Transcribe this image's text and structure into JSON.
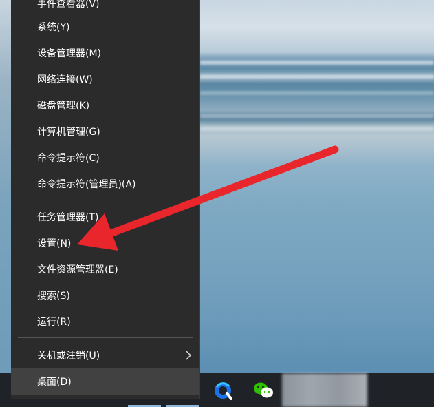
{
  "context_menu": {
    "items": [
      {
        "label": "事件查看器(V)"
      },
      {
        "label": "系统(Y)"
      },
      {
        "label": "设备管理器(M)"
      },
      {
        "label": "网络连接(W)"
      },
      {
        "label": "磁盘管理(K)"
      },
      {
        "label": "计算机管理(G)"
      },
      {
        "label": "命令提示符(C)"
      },
      {
        "label": "命令提示符(管理员)(A)"
      },
      {
        "label": "任务管理器(T)"
      },
      {
        "label": "设置(N)"
      },
      {
        "label": "文件资源管理器(E)"
      },
      {
        "label": "搜索(S)"
      },
      {
        "label": "运行(R)"
      },
      {
        "label": "关机或注销(U)"
      },
      {
        "label": "桌面(D)"
      }
    ],
    "submenu_icon": "chevron-right-icon"
  },
  "taskbar": {
    "icons": [
      "browser-icon",
      "wechat-icon"
    ]
  },
  "annotation": {
    "color": "#e8262b",
    "points_to": "设置(N)"
  },
  "colors": {
    "menu_bg": "#2b2b2b",
    "menu_highlight": "#414141",
    "taskbar_bg": "#1f2227"
  }
}
